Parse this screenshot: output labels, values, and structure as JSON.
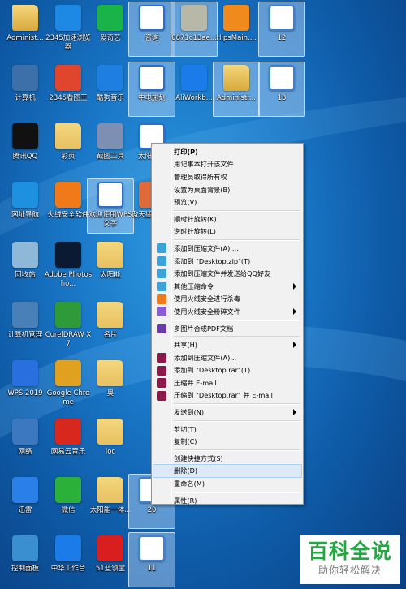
{
  "desktop": {
    "icons": [
      {
        "label": "Administ...",
        "icon": "user-folder-icon",
        "color": "#d9a93a"
      },
      {
        "label": "2345加速浏览器",
        "icon": "browser-e-icon",
        "color": "#1e88e5"
      },
      {
        "label": "爱奇艺",
        "icon": "iqiyi-icon",
        "color": "#19b34a"
      },
      {
        "label": "咨询",
        "icon": "word-doc-icon",
        "color": "#2b6fd6"
      },
      {
        "label": "0871c13ae...",
        "icon": "image-file-icon",
        "color": "#b8b8a8"
      },
      {
        "label": "HipsMain....",
        "icon": "shield-icon",
        "color": "#f08a1c"
      },
      {
        "label": "12",
        "icon": "window-file-icon",
        "color": "#3b7fd6"
      },
      {
        "label": "计算机",
        "icon": "computer-icon",
        "color": "#3d6fa8"
      },
      {
        "label": "2345看图王",
        "icon": "photo-viewer-icon",
        "color": "#e0462e"
      },
      {
        "label": "酷狗音乐",
        "icon": "kugou-icon",
        "color": "#1f7fe0"
      },
      {
        "label": "中电施划",
        "icon": "word-doc-icon",
        "color": "#2b6fd6"
      },
      {
        "label": "AliWorkb...",
        "icon": "aliwork-icon",
        "color": "#1b7be8"
      },
      {
        "label": "Administr...",
        "icon": "user-folder-icon",
        "color": "#d9a93a"
      },
      {
        "label": "13",
        "icon": "window-file-icon",
        "color": "#3b7fd6"
      },
      {
        "label": "腾讯QQ",
        "icon": "qq-penguin-icon",
        "color": "#111111"
      },
      {
        "label": "彩页",
        "icon": "folder-icon",
        "color": "#e8c060"
      },
      {
        "label": "截图工具",
        "icon": "scissors-icon",
        "color": "#7d8fb3"
      },
      {
        "label": "太阳能灯",
        "icon": "word-doc-icon",
        "color": "#2b6fd6"
      },
      {
        "label": "网址导航",
        "icon": "ie-icon",
        "color": "#1e90e0"
      },
      {
        "label": "火绒安全软件",
        "icon": "huorong-shield-icon",
        "color": "#f07a1a"
      },
      {
        "label": "欢迎使用WPS文字",
        "icon": "word-doc-icon",
        "color": "#2b6fd6"
      },
      {
        "label": "傲天猛虎顶...",
        "icon": "image-file-icon",
        "color": "#e06a3a"
      },
      {
        "label": "回收站",
        "icon": "recycle-bin-icon",
        "color": "#8fb8d8"
      },
      {
        "label": "Adobe Photosho...",
        "icon": "photoshop-icon",
        "color": "#0a1a33"
      },
      {
        "label": "太阳能",
        "icon": "folder-icon",
        "color": "#e8c060"
      },
      {
        "label": "计算机管理",
        "icon": "computer-manage-icon",
        "color": "#4a80b8"
      },
      {
        "label": "CorelDRAW X7",
        "icon": "coreldraw-icon",
        "color": "#2f9a3a"
      },
      {
        "label": "名片",
        "icon": "folder-icon",
        "color": "#e8c060"
      },
      {
        "label": "WPS 2019",
        "icon": "wps-icon",
        "color": "#2a6fe0"
      },
      {
        "label": "Google Chrome",
        "icon": "chrome-icon",
        "color": "#e0a020"
      },
      {
        "label": "奥",
        "icon": "folder-icon",
        "color": "#e8c060"
      },
      {
        "label": "网络",
        "icon": "network-icon",
        "color": "#3b78c0"
      },
      {
        "label": "网易云音乐",
        "icon": "netease-music-icon",
        "color": "#d8271c"
      },
      {
        "label": "loc",
        "icon": "folder-icon",
        "color": "#e8c060"
      },
      {
        "label": "迅雷",
        "icon": "thunder-icon",
        "color": "#2a7fe8"
      },
      {
        "label": "微信",
        "icon": "wechat-icon",
        "color": "#2bb13a"
      },
      {
        "label": "太阳能一体...",
        "icon": "folder-icon",
        "color": "#e8c060"
      },
      {
        "label": "20",
        "icon": "window-file-icon",
        "color": "#3b7fd6"
      },
      {
        "label": "控制面板",
        "icon": "control-panel-icon",
        "color": "#3a8fd0"
      },
      {
        "label": "中华工作台",
        "icon": "work-app-icon",
        "color": "#1b7be8"
      },
      {
        "label": "51蓝领宝",
        "icon": "app-51-icon",
        "color": "#d81e1e"
      },
      {
        "label": "11",
        "icon": "window-file-icon",
        "color": "#3b7fd6"
      }
    ]
  },
  "menu": {
    "items": [
      {
        "label": "打印(P)",
        "bold": true
      },
      {
        "label": "用记事本打开该文件"
      },
      {
        "label": "管理员取得所有权"
      },
      {
        "label": "设置为桌面背景(B)"
      },
      {
        "label": "预览(V)"
      },
      {
        "sep": true
      },
      {
        "label": "顺时针旋转(K)"
      },
      {
        "label": "逆时针旋转(L)"
      },
      {
        "sep": true
      },
      {
        "label": "添加到压缩文件(A) ...",
        "icon": "archive-icon",
        "color": "#3aa3d8"
      },
      {
        "label": "添加到 \"Desktop.zip\"(T)",
        "icon": "archive-icon",
        "color": "#3aa3d8"
      },
      {
        "label": "添加到压缩文件并发送给QQ好友",
        "icon": "archive-icon",
        "color": "#3aa3d8"
      },
      {
        "label": "其他压缩命令",
        "icon": "archive-icon",
        "color": "#3aa3d8",
        "submenu": true
      },
      {
        "label": "使用火绒安全进行杀毒",
        "icon": "huorong-icon",
        "color": "#f07a1a"
      },
      {
        "label": "使用火绒安全粉碎文件",
        "icon": "shredder-icon",
        "color": "#8a5ad8",
        "submenu": true
      },
      {
        "sep": true
      },
      {
        "label": "多图片合成PDF文档",
        "icon": "pdf-merge-icon",
        "color": "#6a3aa8"
      },
      {
        "sep": true
      },
      {
        "label": "共享(H)",
        "submenu": true
      },
      {
        "label": "添加到压缩文件(A)...",
        "icon": "winrar-icon",
        "color": "#8b1a4a"
      },
      {
        "label": "添加到 \"Desktop.rar\"(T)",
        "icon": "winrar-icon",
        "color": "#8b1a4a"
      },
      {
        "label": "压缩并 E-mail...",
        "icon": "winrar-icon",
        "color": "#8b1a4a"
      },
      {
        "label": "压缩到 \"Desktop.rar\" 并 E-mail",
        "icon": "winrar-icon",
        "color": "#8b1a4a"
      },
      {
        "sep": true
      },
      {
        "label": "发送到(N)",
        "submenu": true
      },
      {
        "sep": true
      },
      {
        "label": "剪切(T)"
      },
      {
        "label": "复制(C)"
      },
      {
        "sep": true
      },
      {
        "label": "创建快捷方式(S)"
      },
      {
        "label": "删除(D)",
        "highlight": true
      },
      {
        "label": "重命名(M)"
      },
      {
        "sep": true
      },
      {
        "label": "属性(R)"
      }
    ]
  },
  "watermark": {
    "title": "百科全说",
    "subtitle": "助你轻松解决"
  }
}
